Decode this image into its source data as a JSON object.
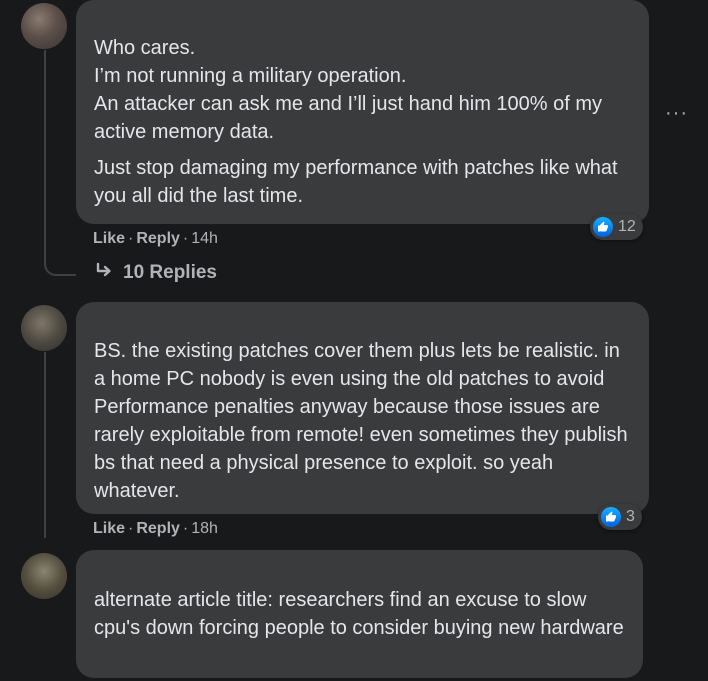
{
  "comments": [
    {
      "paragraphs": [
        "Who cares.\nI’m not running a military operation.\nAn attacker can ask me and I’ll just hand him 100% of my active memory data.",
        "Just stop damaging my performance with patches like what you all did the last time."
      ],
      "like_label": "Like",
      "reply_label": "Reply",
      "time": "14h",
      "reaction_count": "12",
      "replies_label": "10 Replies"
    },
    {
      "paragraphs": [
        "BS. the existing patches cover them plus lets be realistic. in a home PC nobody is even using the old patches to avoid Performance penalties anyway because those issues are rarely exploitable from remote! even sometimes they publish bs that need a physical presence to exploit. so yeah whatever."
      ],
      "like_label": "Like",
      "reply_label": "Reply",
      "time": "18h",
      "reaction_count": "3"
    },
    {
      "paragraphs": [
        "alternate article title: researchers find an excuse to slow cpu's down forcing people to consider buying new hardware"
      ]
    }
  ],
  "more_options": "···",
  "icons": {
    "reaction": "thumbs-up-icon",
    "replies": "reply-arrow-icon",
    "more": "more-options-icon"
  },
  "colors": {
    "background": "#18191a",
    "bubble": "#3a3b3c",
    "text": "#e4e6eb",
    "secondary": "#b0b3b8",
    "like_blue": "#1877f2"
  }
}
